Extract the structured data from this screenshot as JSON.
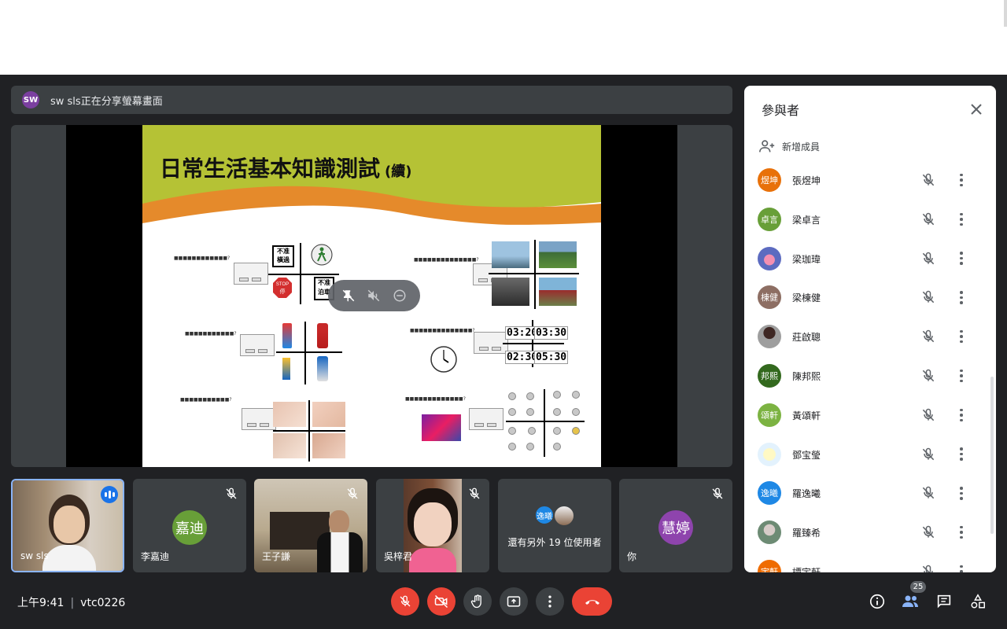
{
  "presenter": {
    "avatar": "SW",
    "text": "sw sls正在分享螢幕畫面"
  },
  "slide": {
    "title": "日常生活基本知識測試",
    "title_suffix": "(續)",
    "signs": [
      "不准\n橫過",
      "STOP\n停",
      "不准\n泊車"
    ],
    "clock_times": [
      "03:20",
      "03:30",
      "02:30",
      "05:30"
    ]
  },
  "overlay": {
    "icons": [
      "unpin-icon",
      "mute-audio-icon",
      "remove-icon"
    ]
  },
  "tiles": [
    {
      "name": "sw sls",
      "type": "video",
      "speaking": true
    },
    {
      "name": "李嘉迪",
      "avatar": "嘉迪",
      "color": "#689f38",
      "muted": true
    },
    {
      "name": "王子謙",
      "type": "video",
      "muted": true
    },
    {
      "name": "吳梓君",
      "type": "video",
      "muted": true
    },
    {
      "name": "還有另外 19 位使用者",
      "avatar": "逸曦",
      "color": "#1e88e5"
    },
    {
      "name": "你",
      "avatar": "慧婷",
      "color": "#8e44ad",
      "muted": true
    }
  ],
  "bottom": {
    "time": "上午9:41",
    "meeting_code": "vtc0226",
    "participant_count": "25"
  },
  "panel": {
    "title": "參與者",
    "add_label": "新增成員",
    "participants": [
      {
        "initials": "煜坤",
        "name": "張煜坤",
        "color": "#e8710a"
      },
      {
        "initials": "卓言",
        "name": "梁卓言",
        "color": "#689f38"
      },
      {
        "initials": "",
        "name": "梁珈瑋",
        "color": "#5c6bc0"
      },
      {
        "initials": "棟健",
        "name": "梁棟健",
        "color": "#8d6e63"
      },
      {
        "initials": "",
        "name": "莊啟聰",
        "color": "#616161"
      },
      {
        "initials": "邦熙",
        "name": "陳邦熙",
        "color": "#33691e"
      },
      {
        "initials": "頌軒",
        "name": "黃頌軒",
        "color": "#7cb342"
      },
      {
        "initials": "",
        "name": "鄧宝瑩",
        "color": "#e3f2fd"
      },
      {
        "initials": "逸曦",
        "name": "羅逸曦",
        "color": "#1e88e5"
      },
      {
        "initials": "",
        "name": "羅臻希",
        "color": "#6d8b74"
      },
      {
        "initials": "宇軒",
        "name": "譚宇軒",
        "color": "#ef6c00"
      }
    ]
  }
}
